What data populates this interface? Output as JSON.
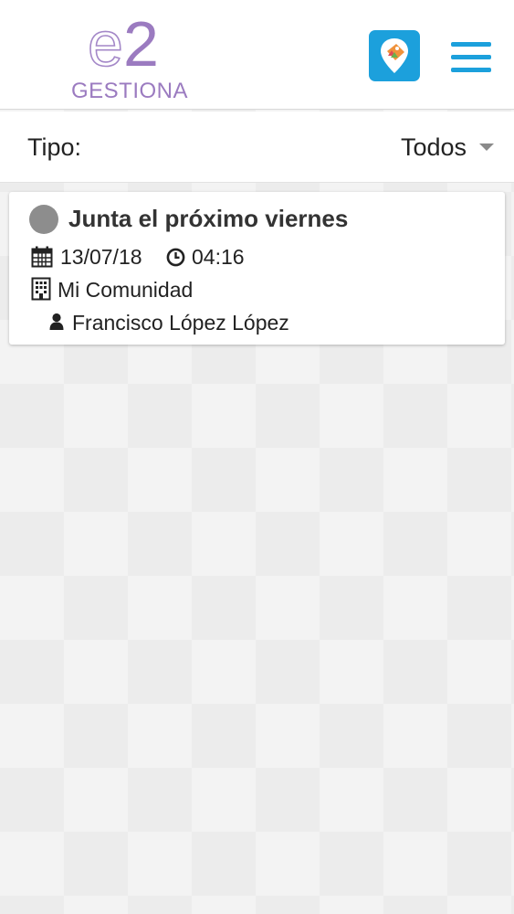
{
  "header": {
    "logo_mark_e": "e",
    "logo_mark_2": "2",
    "logo_text": "GESTIONA",
    "brand_color": "#9b7bc0",
    "accent_color": "#1ca0dc"
  },
  "filter": {
    "label": "Tipo:",
    "selected": "Todos"
  },
  "events": [
    {
      "title": "Junta el próximo viernes",
      "date": "13/07/18",
      "time": "04:16",
      "community": "Mi Comunidad",
      "person": "Francisco López López",
      "status_color": "#8d8d8d"
    }
  ],
  "icons": {
    "app": "tag-location-app-icon",
    "menu": "hamburger-menu-icon",
    "date": "calendar-icon",
    "time": "clock-icon",
    "community": "building-icon",
    "person": "user-icon"
  }
}
